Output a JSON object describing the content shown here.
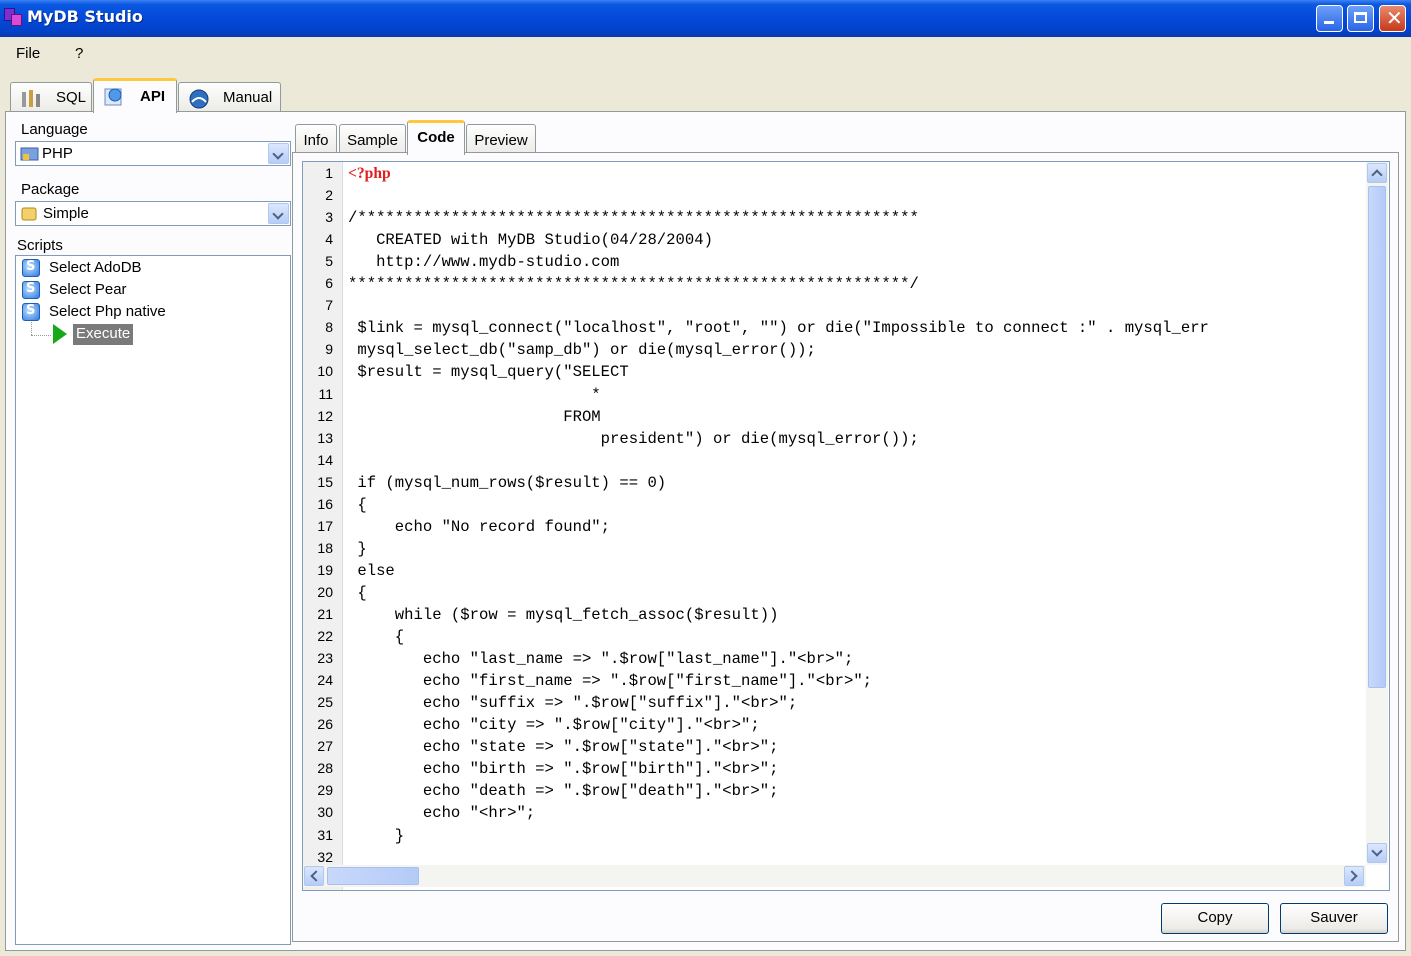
{
  "window": {
    "title": "MyDB Studio"
  },
  "menu": {
    "file": "File",
    "help": "?"
  },
  "main_tabs": [
    {
      "label": "SQL",
      "icon": "sql-tools-icon"
    },
    {
      "label": "API",
      "icon": "api-globe-icon",
      "active": true
    },
    {
      "label": "Manual",
      "icon": "manual-icon"
    }
  ],
  "left": {
    "language_label": "Language",
    "language_value": "PHP",
    "package_label": "Package",
    "package_value": "Simple",
    "scripts_label": "Scripts",
    "scripts": [
      "Select AdoDB",
      "Select Pear",
      "Select Php native"
    ],
    "execute_label": "Execute"
  },
  "sub_tabs": [
    {
      "label": "Info"
    },
    {
      "label": "Sample"
    },
    {
      "label": "Code",
      "active": true
    },
    {
      "label": "Preview"
    }
  ],
  "code_lines": [
    "<?php",
    "",
    "/************************************************************",
    "   CREATED with MyDB Studio(04/28/2004)",
    "   http://www.mydb-studio.com",
    "************************************************************/",
    "",
    " $link = mysql_connect(\"localhost\", \"root\", \"\") or die(\"Impossible to connect :\" . mysql_err",
    " mysql_select_db(\"samp_db\") or die(mysql_error());",
    " $result = mysql_query(\"SELECT",
    "                          *",
    "                       FROM",
    "                           president\") or die(mysql_error());",
    "",
    " if (mysql_num_rows($result) == 0)",
    " {",
    "     echo \"No record found\";",
    " }",
    " else",
    " {",
    "     while ($row = mysql_fetch_assoc($result))",
    "     {",
    "        echo \"last_name => \".$row[\"last_name\"].\"<br>\";",
    "        echo \"first_name => \".$row[\"first_name\"].\"<br>\";",
    "        echo \"suffix => \".$row[\"suffix\"].\"<br>\";",
    "        echo \"city => \".$row[\"city\"].\"<br>\";",
    "        echo \"state => \".$row[\"state\"].\"<br>\";",
    "        echo \"birth => \".$row[\"birth\"].\"<br>\";",
    "        echo \"death => \".$row[\"death\"].\"<br>\";",
    "        echo \"<hr>\";",
    "     }",
    ""
  ],
  "buttons": {
    "copy": "Copy",
    "save": "Sauver"
  }
}
